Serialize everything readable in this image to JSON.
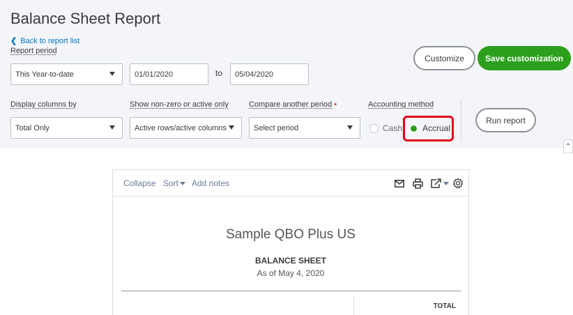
{
  "page": {
    "title": "Balance Sheet Report",
    "back_link": "Back to report list"
  },
  "report_period": {
    "label": "Report period",
    "preset": "This Year-to-date",
    "from": "01/01/2020",
    "to_label": "to",
    "to": "05/04/2020"
  },
  "actions": {
    "customize": "Customize",
    "save_customization": "Save customization",
    "run_report": "Run report"
  },
  "filters": {
    "display_columns": {
      "label": "Display columns by",
      "value": "Total Only"
    },
    "show_nonzero": {
      "label": "Show non-zero or active only",
      "value": "Active rows/active columns"
    },
    "compare_period": {
      "label": "Compare another period",
      "required_mark": "•",
      "value": "Select period"
    },
    "accounting_method": {
      "label": "Accounting method",
      "cash": "Cash",
      "accrual": "Accrual",
      "selected": "Accrual"
    }
  },
  "toolbar": {
    "collapse": "Collapse",
    "sort": "Sort",
    "add_notes": "Add notes"
  },
  "report": {
    "company": "Sample QBO Plus US",
    "title": "BALANCE SHEET",
    "as_of": "As of May 4, 2020",
    "column_total": "TOTAL"
  },
  "colors": {
    "accent_green": "#2ca01c",
    "link_blue": "#0077c5",
    "highlight_red": "#e3001b"
  },
  "icons": [
    "chevron-left-icon",
    "caret-down-icon",
    "email-icon",
    "print-icon",
    "export-icon",
    "gear-icon",
    "chevron-up-icon"
  ]
}
